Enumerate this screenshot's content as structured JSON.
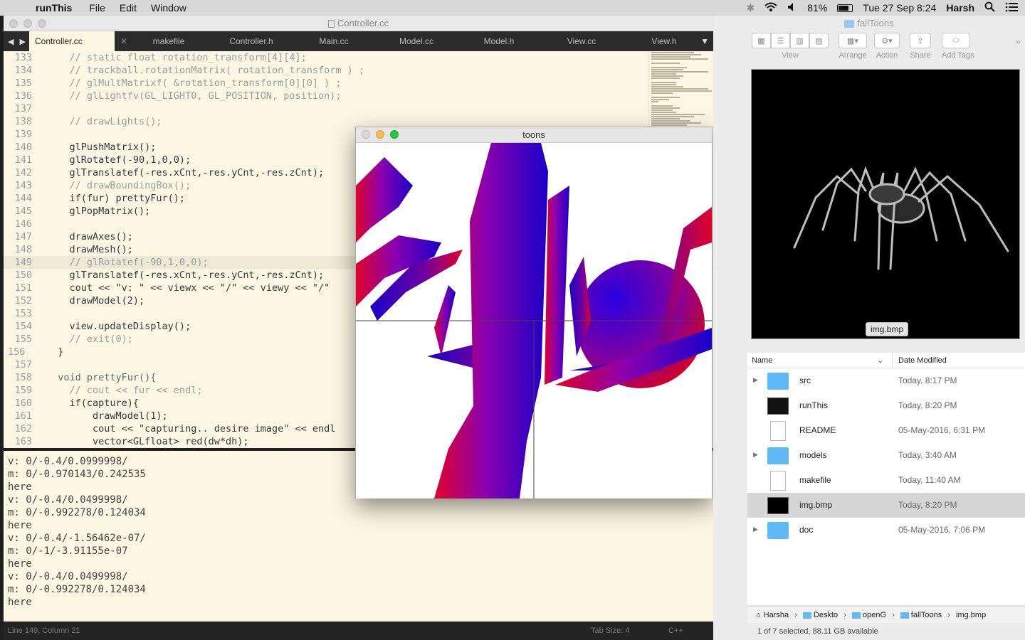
{
  "menubar": {
    "app_name": "runThis",
    "menus": [
      "File",
      "Edit",
      "Window"
    ],
    "battery": "81%",
    "datetime": "Tue 27 Sep  8:24",
    "user": "Harsh"
  },
  "editor": {
    "title": "Controller.cc",
    "tabs": [
      "Controller.cc",
      "makefile",
      "Controller.h",
      "Main.cc",
      "Model.cc",
      "Model.h",
      "View.cc",
      "View.h"
    ],
    "lines": [
      {
        "n": "133",
        "t": "    // static float rotation_transform[4][4];"
      },
      {
        "n": "134",
        "t": "    // trackball.rotationMatrix( rotation_transform ) ;"
      },
      {
        "n": "135",
        "t": "    // glMultMatrixf( &rotation_transform[0][0] ) ;"
      },
      {
        "n": "136",
        "t": "    // glLightfv(GL_LIGHT0, GL_POSITION, position);"
      },
      {
        "n": "137",
        "t": ""
      },
      {
        "n": "138",
        "t": "    // drawLights();"
      },
      {
        "n": "139",
        "t": ""
      },
      {
        "n": "140",
        "t": "    glPushMatrix();"
      },
      {
        "n": "141",
        "t": "    glRotatef(-90,1,0,0);"
      },
      {
        "n": "142",
        "t": "    glTranslatef(-res.xCnt,-res.yCnt,-res.zCnt);"
      },
      {
        "n": "143",
        "t": "    // drawBoundingBox();"
      },
      {
        "n": "144",
        "t": "    if(fur) prettyFur();"
      },
      {
        "n": "145",
        "t": "    glPopMatrix();"
      },
      {
        "n": "146",
        "t": ""
      },
      {
        "n": "147",
        "t": "    drawAxes();"
      },
      {
        "n": "148",
        "t": "    drawMesh();"
      },
      {
        "n": "149",
        "t": "    // glRotatef(-90,1,0,0);"
      },
      {
        "n": "150",
        "t": "    glTranslatef(-res.xCnt,-res.yCnt,-res.zCnt);"
      },
      {
        "n": "151",
        "t": "    cout << \"v: \" << viewx << \"/\" << viewy << \"/\""
      },
      {
        "n": "152",
        "t": "    drawModel(2);"
      },
      {
        "n": "153",
        "t": ""
      },
      {
        "n": "154",
        "t": "    view.updateDisplay();"
      },
      {
        "n": "155",
        "t": "    // exit(0);"
      },
      {
        "n": "156",
        "t": "  }"
      },
      {
        "n": "157",
        "t": ""
      },
      {
        "n": "158",
        "t": "  void prettyFur(){"
      },
      {
        "n": "159",
        "t": "    // cout << fur << endl;"
      },
      {
        "n": "160",
        "t": "    if(capture){"
      },
      {
        "n": "161",
        "t": "        drawModel(1);"
      },
      {
        "n": "162",
        "t": "        cout << \"capturing.. desire image\" << endl"
      },
      {
        "n": "163",
        "t": "        vector<GLfloat> red(dw*dh);"
      }
    ],
    "console": [
      "v: 0/-0.4/0.0999998/",
      "m: 0/-0.970143/0.242535",
      "here",
      "v: 0/-0.4/0.0499998/",
      "m: 0/-0.992278/0.124034",
      "here",
      "v: 0/-0.4/-1.56462e-07/",
      "m: 0/-1/-3.91155e-07",
      "here",
      "v: 0/-0.4/0.0499998/",
      "m: 0/-0.992278/0.124034",
      "here"
    ],
    "status": {
      "position": "Line 149, Column 21",
      "tab_size": "Tab Size: 4",
      "syntax": "C++"
    }
  },
  "toons": {
    "title": "toons"
  },
  "finder": {
    "title": "fallToons",
    "toolbar": {
      "view": "View",
      "arrange": "Arrange",
      "action": "Action",
      "share": "Share",
      "tags": "Add Tags"
    },
    "preview_caption": "img.bmp",
    "columns": {
      "name": "Name",
      "date": "Date Modified"
    },
    "rows": [
      {
        "name": "src",
        "date": "Today, 8:17 PM",
        "kind": "folder"
      },
      {
        "name": "runThis",
        "date": "Today, 8:20 PM",
        "kind": "exe"
      },
      {
        "name": "README",
        "date": "05-May-2016, 6:31 PM",
        "kind": "doc"
      },
      {
        "name": "models",
        "date": "Today, 3:40 AM",
        "kind": "folder"
      },
      {
        "name": "makefile",
        "date": "Today, 11:40 AM",
        "kind": "doc"
      },
      {
        "name": "img.bmp",
        "date": "Today, 8:20 PM",
        "kind": "thumb"
      },
      {
        "name": "doc",
        "date": "05-May-2016, 7:06 PM",
        "kind": "folder"
      }
    ],
    "path": [
      "Harsha",
      "Deskto",
      "openG",
      "fallToons",
      "img.bmp"
    ],
    "status": "1 of 7 selected, 88.11 GB available"
  }
}
